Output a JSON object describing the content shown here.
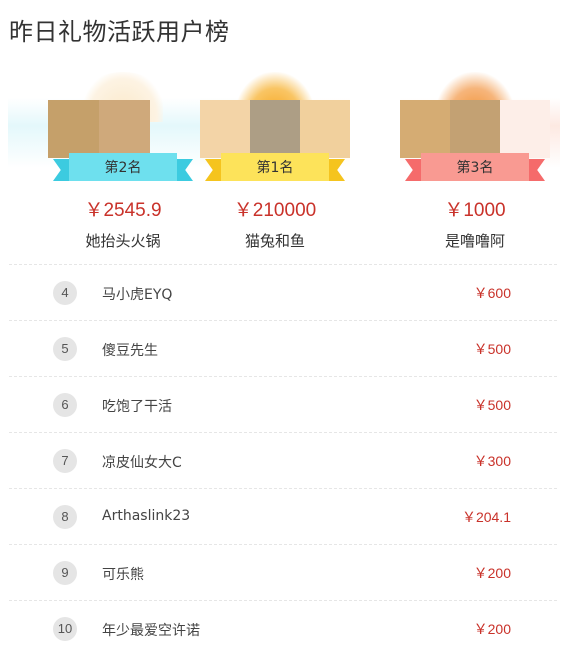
{
  "page": {
    "title": "昨日礼物活跃用户榜"
  },
  "podium": [
    {
      "rank_label": "第2名",
      "amount": "￥2545.9",
      "name": "她抬头火锅",
      "avatar_colors": [
        "#c5a06a",
        "#cfa97b"
      ]
    },
    {
      "rank_label": "第1名",
      "amount": "￥210000",
      "name": "猫兔和鱼",
      "avatar_colors": [
        "#f3d4a7",
        "#ad9e85",
        "#f1d09d"
      ]
    },
    {
      "rank_label": "第3名",
      "amount": "￥1000",
      "name": "是噜噜阿",
      "avatar_colors": [
        "#d5ac73",
        "#c3a173",
        "#fdeee8"
      ]
    }
  ],
  "list": [
    {
      "rank": "4",
      "name": "马小虎EYQ",
      "amount": "￥600"
    },
    {
      "rank": "5",
      "name": "傻豆先生",
      "amount": "￥500"
    },
    {
      "rank": "6",
      "name": "吃饱了干活",
      "amount": "￥500"
    },
    {
      "rank": "7",
      "name": "凉皮仙女大C",
      "amount": "￥300"
    },
    {
      "rank": "8",
      "name": "Arthaslink23",
      "amount": "￥204.1"
    },
    {
      "rank": "9",
      "name": "可乐熊",
      "amount": "￥200"
    },
    {
      "rank": "10",
      "name": "年少最爱空许诺",
      "amount": "￥200"
    }
  ]
}
